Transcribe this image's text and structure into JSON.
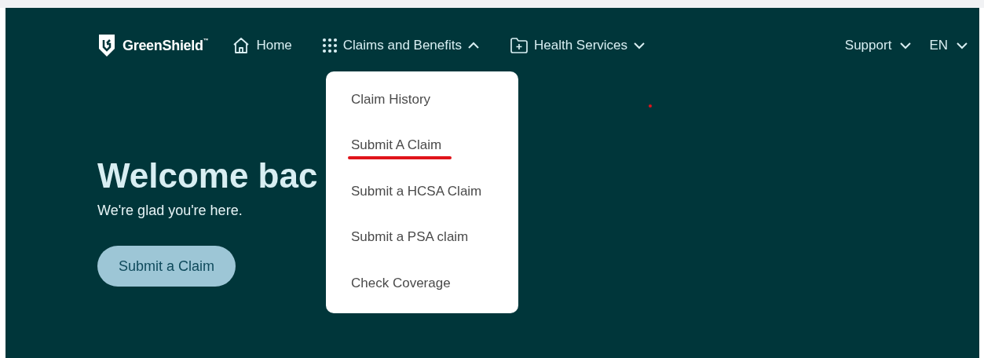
{
  "brand": {
    "name": "GreenShield",
    "mark": "™"
  },
  "nav": [
    {
      "kind": "home",
      "label": "Home"
    },
    {
      "kind": "grid",
      "label": "Claims and Benefits",
      "expanded": true
    },
    {
      "kind": "folder",
      "label": "Health Services",
      "expanded": false
    }
  ],
  "nav_right": [
    {
      "label": "Support",
      "expanded": false
    },
    {
      "label": "EN",
      "expanded": false
    }
  ],
  "menu": [
    {
      "label": "Claim History",
      "marked": false
    },
    {
      "label": "Submit A Claim",
      "marked": true
    },
    {
      "label": "Submit a HCSA Claim",
      "marked": false
    },
    {
      "label": "Submit a PSA claim",
      "marked": false
    },
    {
      "label": "Check Coverage",
      "marked": false
    }
  ],
  "hero": {
    "heading": "Welcome bac",
    "subtitle": "We're glad you're here.",
    "button": "Submit a Claim"
  },
  "annotations": [
    {
      "kind": "dot"
    }
  ]
}
